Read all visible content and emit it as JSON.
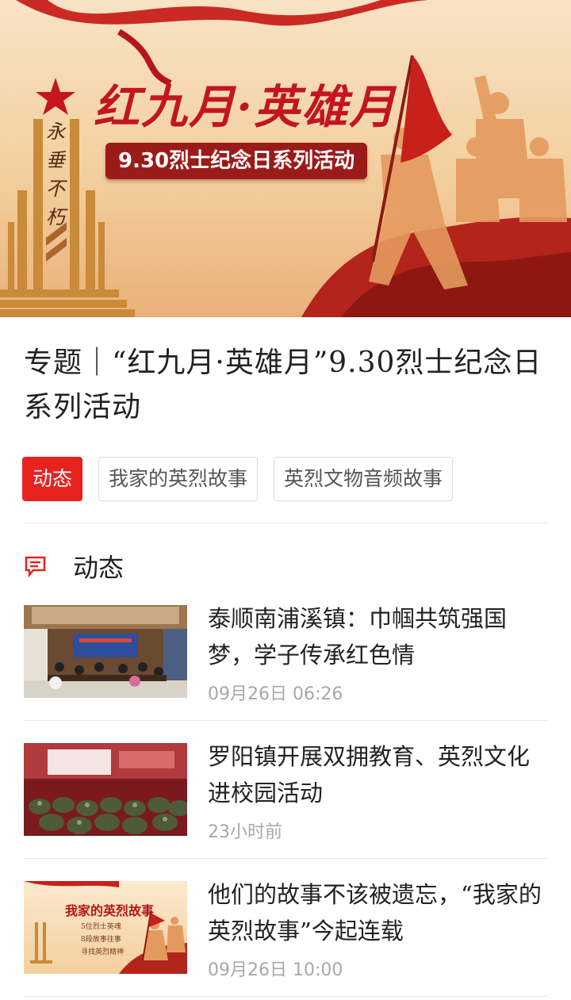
{
  "banner": {
    "title": "红九月·英雄月",
    "subtitle": "9.30烈士纪念日系列活动",
    "monument_text": "永垂不朽"
  },
  "page": {
    "title": "专题｜“红九月·英雄月”9.30烈士纪念日系列活动"
  },
  "tabs": [
    {
      "label": "动态",
      "active": true
    },
    {
      "label": "我家的英烈故事",
      "active": false
    },
    {
      "label": "英烈文物音频故事",
      "active": false
    }
  ],
  "section": {
    "label": "动态",
    "icon": "news-icon"
  },
  "articles": [
    {
      "title": "泰顺南浦溪镇：巾帼共筑强国梦，学子传承红色情",
      "time": "09月26日  06:26"
    },
    {
      "title": "罗阳镇开展双拥教育、英烈文化进校园活动",
      "time": "23小时前"
    },
    {
      "title": "他们的故事不该被遗忘，“我家的英烈故事”今起连载",
      "time": "09月26日  10:00"
    }
  ],
  "thumb3": {
    "title": "我家的英烈故事",
    "lines": [
      "5位烈士英魂",
      "8段故事往事",
      "寻找英烈精神"
    ]
  },
  "colors": {
    "accent": "#e8221e",
    "banner_red": "#c4161c",
    "meta_gray": "#a8a8a8"
  }
}
